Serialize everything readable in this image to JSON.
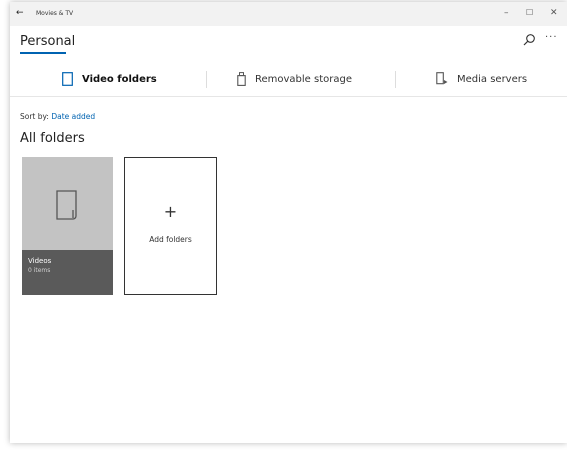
{
  "window": {
    "app_title": "Movies & TV",
    "back_glyph": "←",
    "minimize_glyph": "–",
    "maximize_glyph": "☐",
    "close_glyph": "✕"
  },
  "header": {
    "title": "Personal",
    "more_glyph": "···"
  },
  "tabs": [
    {
      "label": "Video folders",
      "icon": "folder-icon",
      "selected": true
    },
    {
      "label": "Removable storage",
      "icon": "usb-drive-icon",
      "selected": false
    },
    {
      "label": "Media servers",
      "icon": "media-server-icon",
      "selected": false
    }
  ],
  "sort": {
    "prefix": "Sort by:",
    "value": "Date added"
  },
  "section": {
    "title": "All folders"
  },
  "folders": [
    {
      "name": "Videos",
      "count": "0 items",
      "icon": "folder-icon"
    }
  ],
  "add_tile": {
    "plus": "+",
    "label": "Add folders"
  },
  "colors": {
    "accent": "#0063b1",
    "tile_bg": "#c3c3c3",
    "tile_label_bg": "#5a5a5a"
  }
}
